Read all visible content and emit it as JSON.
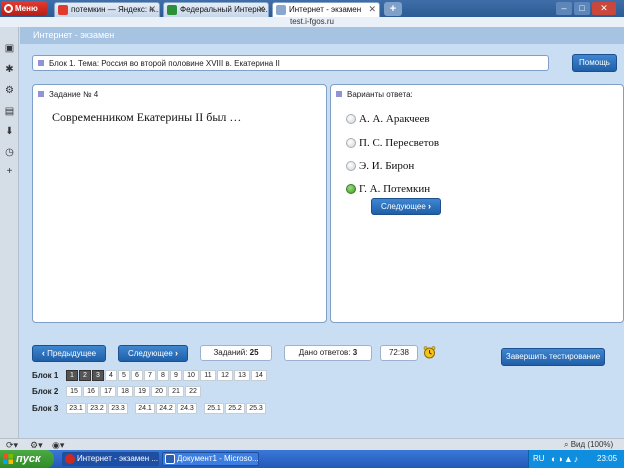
{
  "browser": {
    "menu_label": "Меню",
    "tabs": [
      {
        "label": "потемкин — Яндекс: н..."
      },
      {
        "label": "Федеральный Интерне..."
      },
      {
        "label": "Интернет - экзамен"
      }
    ],
    "url": "test.i-fgos.ru",
    "new_tab_label": "+",
    "minimize": "–",
    "maximize": "□",
    "close": "✕"
  },
  "app": {
    "title": "Интернет - экзамен",
    "block_topic": "Блок 1. Тема: Россия во второй половине XVIII в. Екатерина II",
    "help_label": "Помощь"
  },
  "task": {
    "header": "Задание № 4",
    "question": "Современником Екатерины II был …"
  },
  "answers": {
    "header": "Варианты ответа:",
    "options": [
      {
        "label": "А. А. Аракчеев",
        "selected": false
      },
      {
        "label": "П. С. Пересветов",
        "selected": false
      },
      {
        "label": "Э. И. Бирон",
        "selected": false
      },
      {
        "label": "Г. А. Потемкин",
        "selected": true
      }
    ],
    "next_label": "Следующее"
  },
  "nav": {
    "prev_label": "Предыдущее",
    "next_label": "Следующее",
    "tasks_label": "Заданий:",
    "tasks_count": "25",
    "answered_label": "Дано ответов:",
    "answered_count": "3",
    "timer": "72:38",
    "finish_label": "Завершить тестирование"
  },
  "blocks": [
    {
      "label": "Блок 1",
      "items": [
        "1",
        "2",
        "3",
        "4",
        "5",
        "6",
        "7",
        "8",
        "9",
        "10",
        "11",
        "12",
        "13",
        "14"
      ],
      "done": 3
    },
    {
      "label": "Блок 2",
      "items": [
        "15",
        "16",
        "17",
        "18",
        "19",
        "20",
        "21",
        "22"
      ],
      "done": 0
    },
    {
      "label": "Блок 3",
      "items": [
        "23.1",
        "23.2",
        "23.3",
        "24.1",
        "24.2",
        "24.3",
        "25.1",
        "25.2",
        "25.3"
      ],
      "done": 0
    }
  ],
  "statusbar": {
    "zoom": "Вид (100%)"
  },
  "taskbar": {
    "start_label": "пуск",
    "tasks": [
      {
        "label": "Интернет - экзамен ..."
      },
      {
        "label": "Документ1 - Microso..."
      }
    ],
    "lang": "RU",
    "time": "23:05"
  },
  "colors": {
    "accent_blue": "#2a6fbd",
    "page_bg": "#c9def2",
    "opera_red": "#cc2a20",
    "selected_green": "#3b9a22"
  }
}
